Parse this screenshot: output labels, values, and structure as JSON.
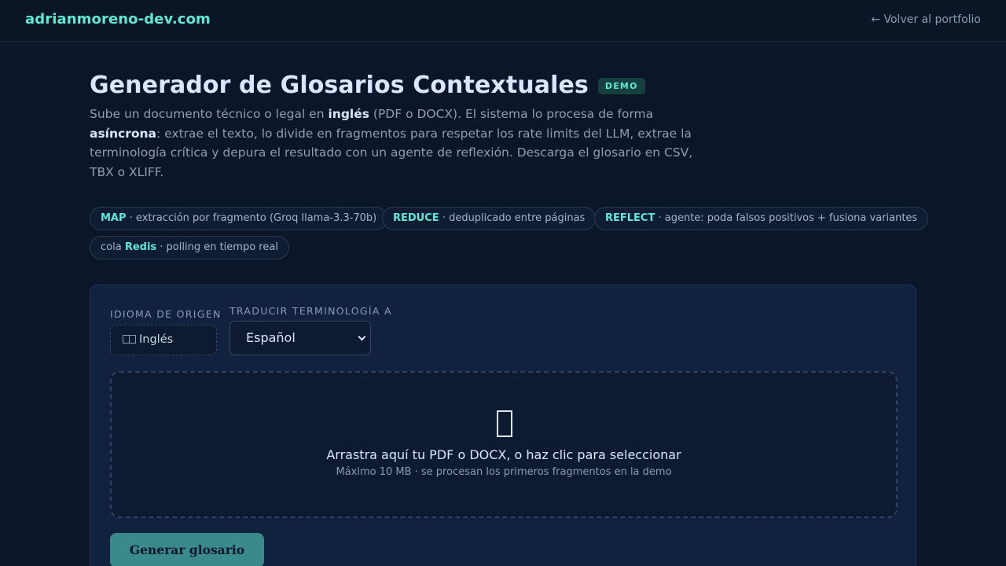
{
  "header": {
    "brand": "adrianmoreno-dev.com",
    "back_link": "← Volver al portfolio"
  },
  "hero": {
    "title": "Generador de Glosarios Contextuales",
    "badge": "DEMO",
    "desc_1": "Sube un documento técnico o legal en ",
    "desc_bold_1": "inglés",
    "desc_2": " (PDF o DOCX). El sistema lo procesa de forma ",
    "desc_bold_2": "asíncrona",
    "desc_3": ": extrae el texto, lo divide en fragmentos para respetar los rate limits del LLM, extrae la terminología crítica y depura el resultado con un agente de reflexión. Descarga el glosario en CSV, TBX o XLIFF."
  },
  "chips": [
    {
      "key": "MAP",
      "text": " · extracción por fragmento (Groq llama-3.3-70b)"
    },
    {
      "key": "REDUCE",
      "text": " · deduplicado entre páginas"
    },
    {
      "key": "REFLECT",
      "text": " · agente: poda falsos positivos + fusiona variantes"
    },
    {
      "prefix": "cola ",
      "key": "Redis",
      "text": " · polling en tiempo real"
    }
  ],
  "form": {
    "source_label": "IDIOMA DE ORIGEN",
    "source_value": "Inglés",
    "target_label": "TRADUCIR TERMINOLOGÍA A",
    "target_value": "Español",
    "drop_title": "Arrastra aquí tu PDF o DOCX, o haz clic para seleccionar",
    "drop_sub": "Máximo 10 MB · se procesan los primeros fragmentos en la demo",
    "submit_label": "Generar glosario",
    "drop_icon": "document-icon",
    "flag_icon": "flag-icon"
  },
  "colors": {
    "accent": "#5eead4",
    "background": "#0b1628",
    "button": "#3a8a8b"
  }
}
